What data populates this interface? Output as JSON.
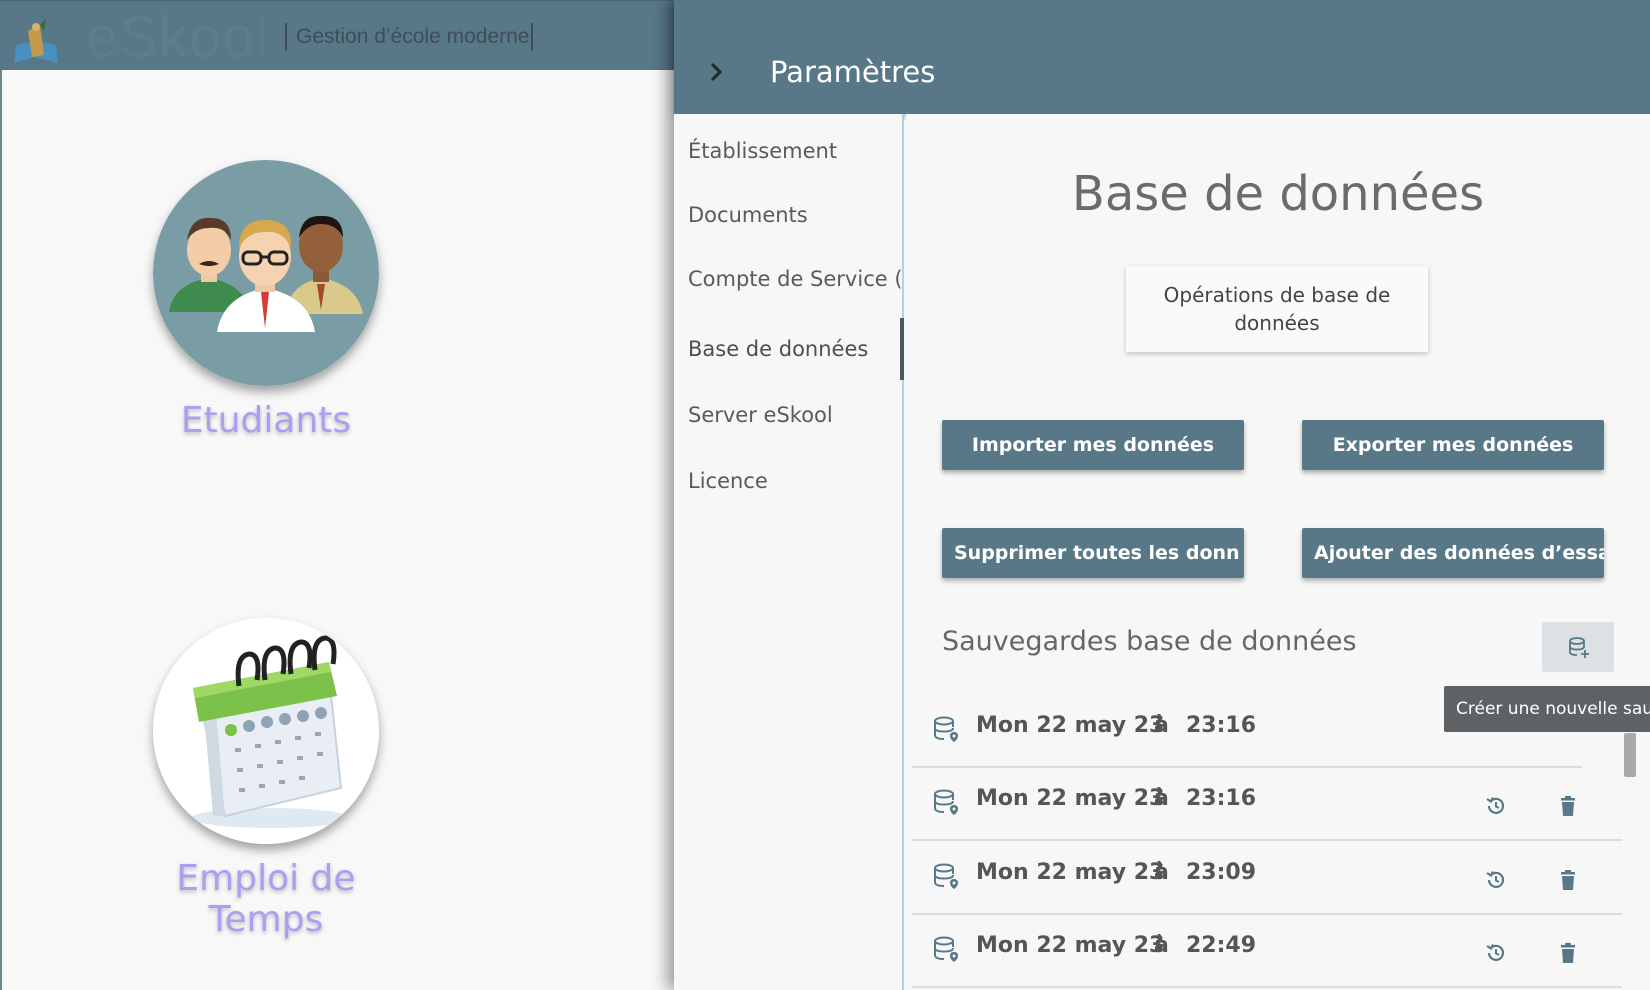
{
  "app": {
    "name": "eSkool",
    "tagline": "Gestion d’école moderne"
  },
  "home": {
    "tiles": [
      {
        "label": "Etudiants"
      },
      {
        "label": "Emploi de Temps"
      }
    ]
  },
  "settings": {
    "title": "Paramètres",
    "nav": [
      {
        "label": "Établissement"
      },
      {
        "label": "Documents"
      },
      {
        "label": "Compte de Service ("
      },
      {
        "label": "Base de données"
      },
      {
        "label": "Server eSkool"
      },
      {
        "label": "Licence"
      }
    ],
    "active_nav": "Base de données",
    "section_title": "Base de données",
    "operations_card": "Opérations de base de données",
    "buttons": {
      "import": "Importer mes données",
      "export": "Exporter mes données",
      "delete_all": "Supprimer toutes les donn",
      "add_test": "Ajouter des données d’essa"
    },
    "backups": {
      "title": "Sauvegardes base de données",
      "tooltip": "Créer une nouvelle sauve",
      "items": [
        {
          "date": "Mon 22 may 23",
          "at": "à",
          "time": "23:16",
          "actions": false
        },
        {
          "date": "Mon 22 may 23",
          "at": "à",
          "time": "23:16",
          "actions": true
        },
        {
          "date": "Mon 22 may 23",
          "at": "à",
          "time": "23:09",
          "actions": true
        },
        {
          "date": "Mon 22 may 23",
          "at": "à",
          "time": "22:49",
          "actions": true
        }
      ]
    }
  },
  "colors": {
    "primary": "#587888",
    "tile_label": "#a9a0f2",
    "tooltip_bg": "#5f6264",
    "nav_divider": "#b5d0e0"
  },
  "icons": {
    "close": "chevron-right-icon",
    "add_backup": "database-plus-icon",
    "backup_item": "database-marker-icon",
    "restore": "restore-icon",
    "delete": "trash-icon"
  }
}
